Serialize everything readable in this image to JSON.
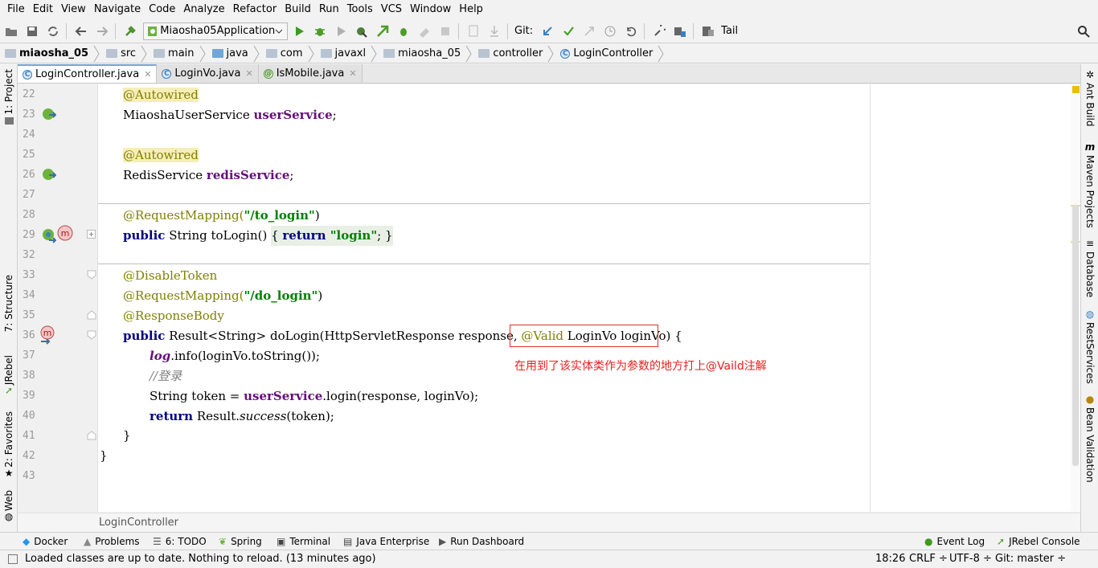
{
  "menu": [
    "File",
    "Edit",
    "View",
    "Navigate",
    "Code",
    "Analyze",
    "Refactor",
    "Build",
    "Run",
    "Tools",
    "VCS",
    "Window",
    "Help"
  ],
  "toolbar": {
    "run_config": "Miaosha05Application",
    "git_label": "Git:",
    "tail_label": "Tail"
  },
  "breadcrumb": [
    "miaosha_05",
    "src",
    "main",
    "java",
    "com",
    "javaxl",
    "miaosha_05",
    "controller",
    "LoginController"
  ],
  "tabs": [
    {
      "label": "LoginController.java",
      "icon": "C"
    },
    {
      "label": "LoginVo.java",
      "icon": "C"
    },
    {
      "label": "IsMobile.java",
      "icon": "@"
    }
  ],
  "gutter": {
    "line_numbers": [
      "22",
      "23",
      "24",
      "25",
      "26",
      "27",
      "28",
      "29",
      "32",
      "33",
      "34",
      "35",
      "36",
      "37",
      "38",
      "39",
      "40",
      "41",
      "42",
      "43"
    ]
  },
  "code": {
    "l22_ann": "@Autowired",
    "l23_type": "MiaoshaUserService ",
    "l23_field": "userService",
    "l23_end": ";",
    "l25_ann": "@Autowired",
    "l26_type": "RedisService ",
    "l26_field": "redisService",
    "l26_end": ";",
    "l28_ann": "@RequestMapping(",
    "l28_str": "\"/to_login\"",
    "l28_end": ")",
    "l29_kw": "public",
    "l29_mid": " String toLogin() ",
    "l29_open": "{ ",
    "l29_ret": "return",
    "l29_str": " \"login\"",
    "l29_close": "; }",
    "l33_ann": "@DisableToken",
    "l34_ann": "@RequestMapping(",
    "l34_str": "\"/do_login\"",
    "l34_end": ")",
    "l35_ann": "@ResponseBody",
    "l36_kw": "public",
    "l36_mid": " Result<String> doLogin(HttpServletResponse response, ",
    "l36_valid": "@Valid",
    "l36_param": " LoginVo loginVo",
    "l36_end": ") {",
    "l37_log": "log",
    "l37_rest": ".info(loginVo.toString());",
    "l38_cmt": "//登录",
    "l39_pre": "String token = ",
    "l39_field": "userService",
    "l39_rest": ".login(response, loginVo);",
    "l40_kw": "return",
    "l40_mid": " Result.",
    "l40_ital": "success",
    "l40_rest": "(token);",
    "l41": "}",
    "l42": "}"
  },
  "annotation_note": "在用到了该实体类作为参数的地方打上@Vaild注解",
  "footer_crumb": "LoginController",
  "left_tabs": [
    "1: Project",
    "7: Structure",
    "JRebel",
    "2: Favorites",
    "Web"
  ],
  "right_tabs": [
    "Ant Build",
    "Maven Projects",
    "Database",
    "RestServices",
    "Bean Validation"
  ],
  "tool_windows": [
    "Docker",
    "Problems",
    "6: TODO",
    "Spring",
    "Terminal",
    "Java Enterprise",
    "Run Dashboard",
    "Event Log",
    "JRebel Console"
  ],
  "status": {
    "message": "Loaded classes are up to date. Nothing to reload. (13 minutes ago)",
    "position": "18:26",
    "line_sep": "CRLF ÷",
    "encoding": "UTF-8 ÷",
    "git": "Git: master ÷"
  },
  "colors": {
    "keyword": "#000080",
    "annotation": "#808000",
    "string": "#008000",
    "field": "#660e7a",
    "note": "#e8201f"
  }
}
